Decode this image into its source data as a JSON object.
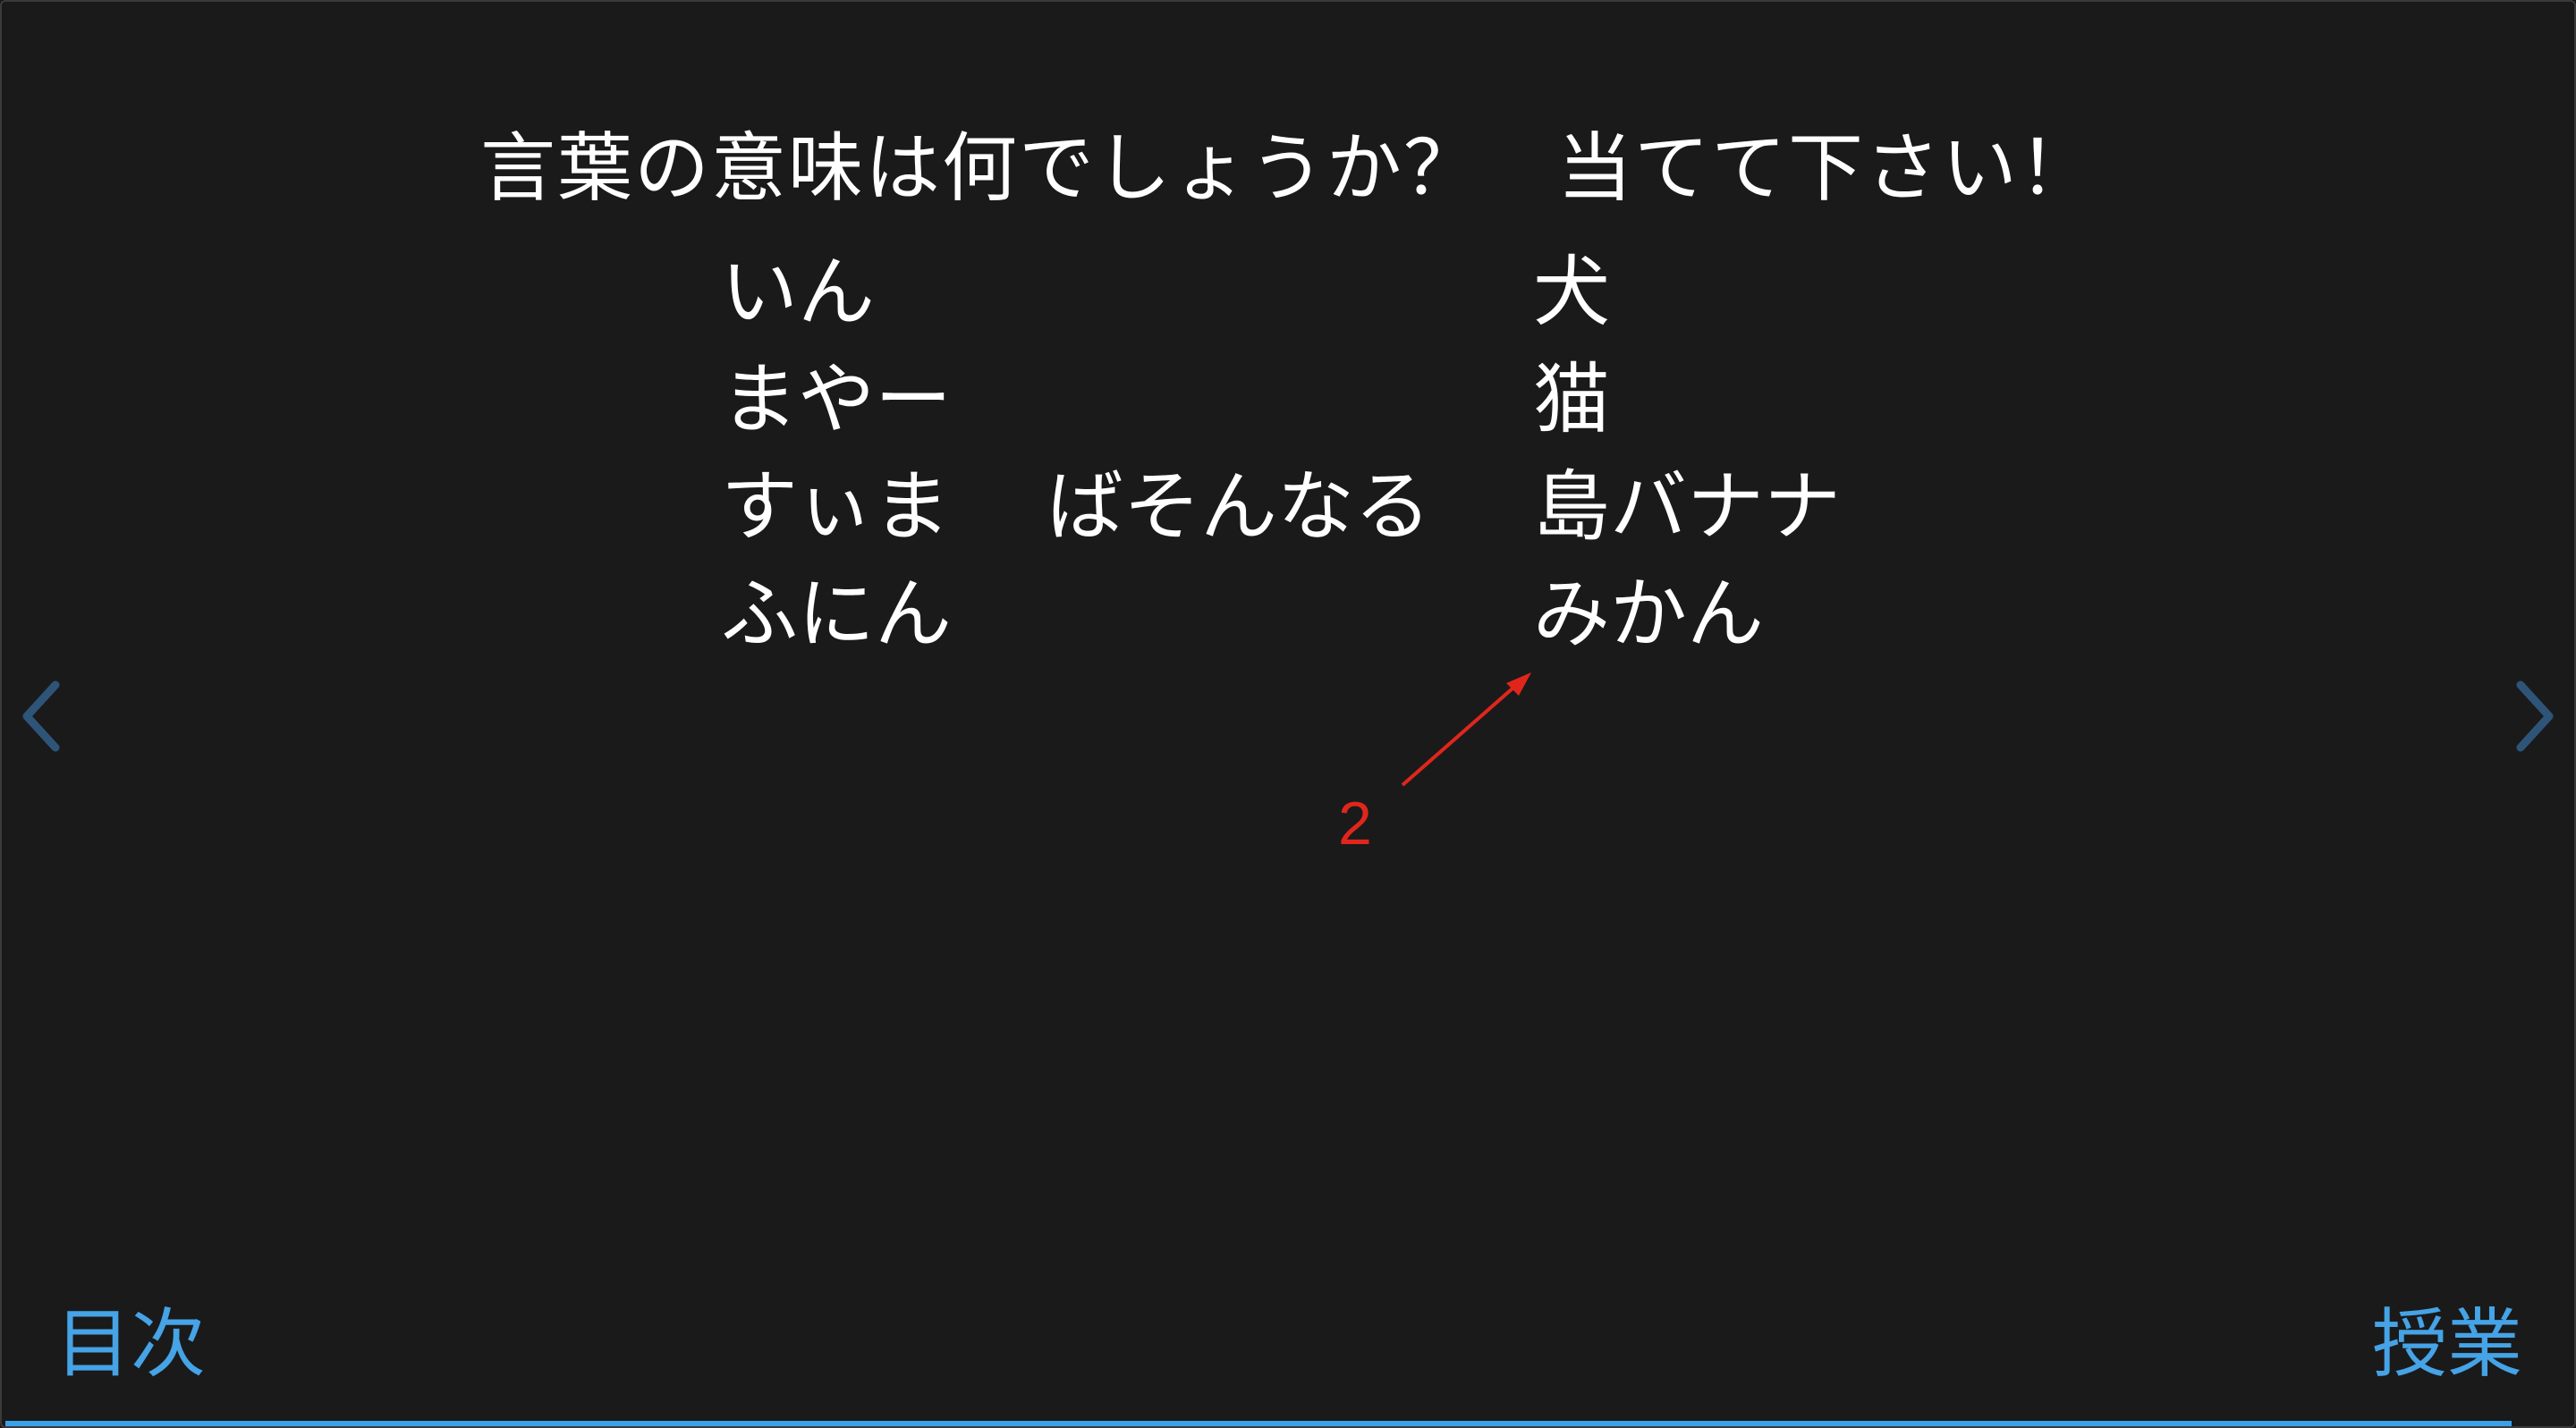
{
  "slide": {
    "title": "言葉の意味は何でしょうか？　当てて下さい！",
    "words": {
      "left": [
        "いん",
        "まやー",
        "すぃま",
        "ふにん"
      ],
      "middle": "ばそんなる",
      "right": [
        "犬",
        "猫",
        "島バナナ",
        "みかん"
      ]
    }
  },
  "annotation": {
    "number": "2",
    "color": "#e0261c"
  },
  "navigation": {
    "prev_icon": "chevron-left-icon",
    "next_icon": "chevron-right-icon",
    "toc_label": "目次",
    "lesson_label": "授業"
  },
  "progress": {
    "fraction": 0.977
  },
  "colors": {
    "background": "#1a1a1a",
    "text": "#ffffff",
    "accent": "#45a3e6",
    "chevron": "#2e5478",
    "annotation": "#e0261c"
  }
}
